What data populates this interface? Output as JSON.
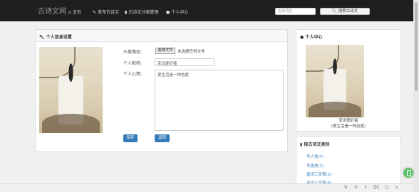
{
  "nav": {
    "brand": "古诗文网",
    "items": [
      {
        "icon": "home-icon",
        "glyph": "⌂",
        "label": "主页"
      },
      {
        "icon": "pencil-icon",
        "glyph": "✎",
        "label": "发布古诗文"
      },
      {
        "icon": "book-icon",
        "glyph": "▮",
        "label": "古诗文分类管理"
      },
      {
        "icon": "user-icon",
        "glyph": "●",
        "label": "个人中心"
      }
    ],
    "search_placeholder": "古诗词名",
    "search_button": "搜索古诗文"
  },
  "profile": {
    "title": "个人信息设置",
    "avatar_label": "头像路径:",
    "file_button": "选择文件",
    "file_status": "未选择任何文件",
    "nickname_label": "个人昵称:",
    "nickname_value": "宋词爱好者",
    "mood_label": "个人心情:",
    "mood_value": "爱生活是一种态度",
    "save_button": "保存",
    "back_button": "返回"
  },
  "sidebar": {
    "title": "个人中心",
    "username": "宋词爱好者",
    "mood": "(爱生活是一种态度)"
  },
  "categories": {
    "title": "按古诗文类别",
    "items": [
      "写人类(7)",
      "写景类(1)",
      "唐诗三百首(2)",
      "宋词三百首(6)"
    ]
  },
  "statusbar": {
    "icons": [
      "pin-icon",
      "history-icon",
      "download-icon",
      "zoom-icon",
      "expand-icon",
      "search-icon"
    ],
    "zoom": "Q1"
  }
}
